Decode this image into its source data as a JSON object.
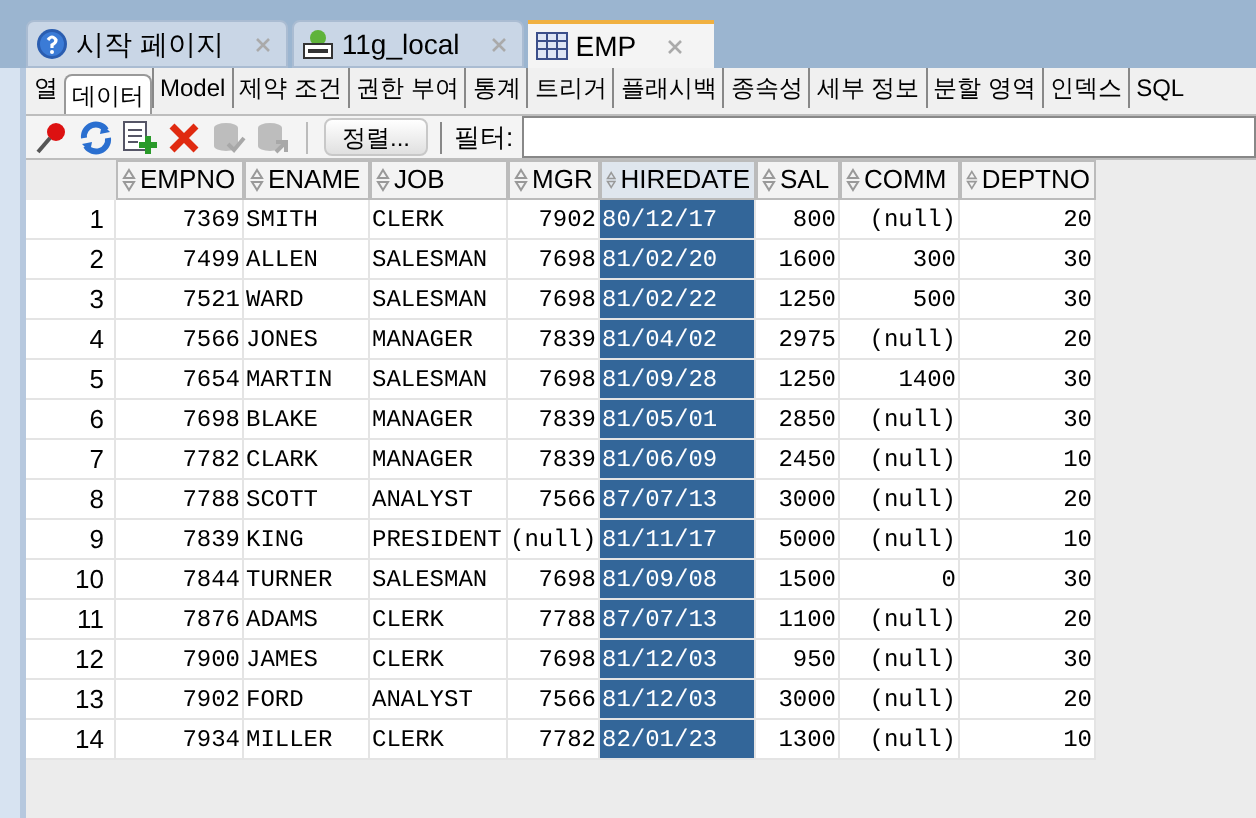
{
  "tabs": [
    {
      "label": "시작 페이지",
      "kind": "help",
      "selected": false
    },
    {
      "label": "11g_local",
      "kind": "connection",
      "selected": false
    },
    {
      "label": "EMP",
      "kind": "table",
      "selected": true
    }
  ],
  "subtabs": [
    {
      "label": "열",
      "selected": false
    },
    {
      "label": "데이터",
      "selected": true
    },
    {
      "label": "Model",
      "selected": false
    },
    {
      "label": "제약 조건",
      "selected": false
    },
    {
      "label": "권한 부여",
      "selected": false
    },
    {
      "label": "통계",
      "selected": false
    },
    {
      "label": "트리거",
      "selected": false
    },
    {
      "label": "플래시백",
      "selected": false
    },
    {
      "label": "종속성",
      "selected": false
    },
    {
      "label": "세부 정보",
      "selected": false
    },
    {
      "label": "분할 영역",
      "selected": false
    },
    {
      "label": "인덱스",
      "selected": false
    },
    {
      "label": "SQL",
      "selected": false
    }
  ],
  "toolbar": {
    "tools": [
      {
        "kind": "pin",
        "disabled": false
      },
      {
        "kind": "refresh",
        "disabled": false
      },
      {
        "kind": "add",
        "disabled": false
      },
      {
        "kind": "delete",
        "disabled": false
      },
      {
        "kind": "commit",
        "disabled": true
      },
      {
        "kind": "rollback",
        "disabled": true
      }
    ],
    "sort_button": "정렬...",
    "filter_label": "필터:"
  },
  "table": {
    "columns": [
      {
        "label": "EMPNO",
        "kind": "number",
        "selected": false
      },
      {
        "label": "ENAME",
        "kind": "text",
        "selected": false
      },
      {
        "label": "JOB",
        "kind": "text",
        "selected": false
      },
      {
        "label": "MGR",
        "kind": "number",
        "selected": false
      },
      {
        "label": "HIREDATE",
        "kind": "text",
        "selected": true
      },
      {
        "label": "SAL",
        "kind": "number",
        "selected": false
      },
      {
        "label": "COMM",
        "kind": "number",
        "selected": false
      },
      {
        "label": "DEPTNO",
        "kind": "number",
        "selected": false
      }
    ],
    "rows": [
      {
        "number": "1",
        "cells": [
          "7369",
          "SMITH",
          "CLERK",
          "7902",
          "80/12/17",
          "800",
          "(null)",
          "20"
        ]
      },
      {
        "number": "2",
        "cells": [
          "7499",
          "ALLEN",
          "SALESMAN",
          "7698",
          "81/02/20",
          "1600",
          "300",
          "30"
        ]
      },
      {
        "number": "3",
        "cells": [
          "7521",
          "WARD",
          "SALESMAN",
          "7698",
          "81/02/22",
          "1250",
          "500",
          "30"
        ]
      },
      {
        "number": "4",
        "cells": [
          "7566",
          "JONES",
          "MANAGER",
          "7839",
          "81/04/02",
          "2975",
          "(null)",
          "20"
        ]
      },
      {
        "number": "5",
        "cells": [
          "7654",
          "MARTIN",
          "SALESMAN",
          "7698",
          "81/09/28",
          "1250",
          "1400",
          "30"
        ]
      },
      {
        "number": "6",
        "cells": [
          "7698",
          "BLAKE",
          "MANAGER",
          "7839",
          "81/05/01",
          "2850",
          "(null)",
          "30"
        ]
      },
      {
        "number": "7",
        "cells": [
          "7782",
          "CLARK",
          "MANAGER",
          "7839",
          "81/06/09",
          "2450",
          "(null)",
          "10"
        ]
      },
      {
        "number": "8",
        "cells": [
          "7788",
          "SCOTT",
          "ANALYST",
          "7566",
          "87/07/13",
          "3000",
          "(null)",
          "20"
        ]
      },
      {
        "number": "9",
        "cells": [
          "7839",
          "KING",
          "PRESIDENT",
          "(null)",
          "81/11/17",
          "5000",
          "(null)",
          "10"
        ]
      },
      {
        "number": "10",
        "cells": [
          "7844",
          "TURNER",
          "SALESMAN",
          "7698",
          "81/09/08",
          "1500",
          "0",
          "30"
        ]
      },
      {
        "number": "11",
        "cells": [
          "7876",
          "ADAMS",
          "CLERK",
          "7788",
          "87/07/13",
          "1100",
          "(null)",
          "20"
        ]
      },
      {
        "number": "12",
        "cells": [
          "7900",
          "JAMES",
          "CLERK",
          "7698",
          "81/12/03",
          "950",
          "(null)",
          "30"
        ]
      },
      {
        "number": "13",
        "cells": [
          "7902",
          "FORD",
          "ANALYST",
          "7566",
          "81/12/03",
          "3000",
          "(null)",
          "20"
        ]
      },
      {
        "number": "14",
        "cells": [
          "7934",
          "MILLER",
          "CLERK",
          "7782",
          "82/01/23",
          "1300",
          "(null)",
          "10"
        ]
      }
    ]
  }
}
